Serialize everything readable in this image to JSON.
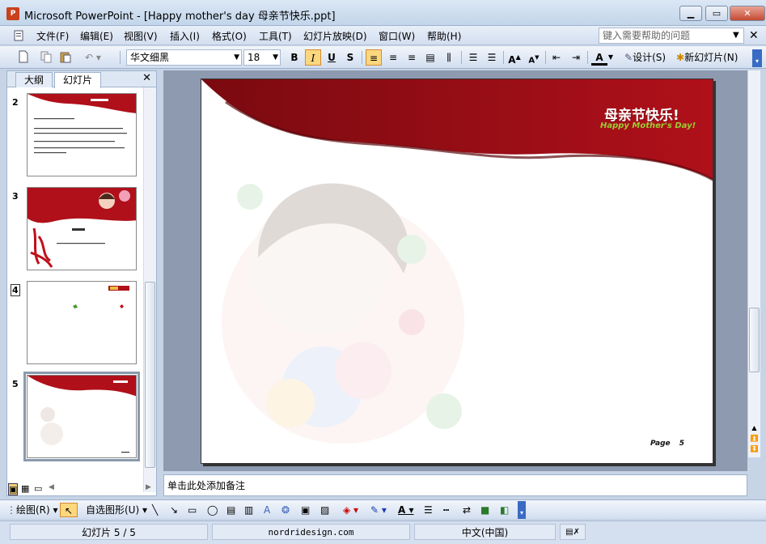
{
  "window": {
    "title": "Microsoft PowerPoint - [Happy mother's day 母亲节快乐.ppt]",
    "app_icon_text": "P"
  },
  "menu": {
    "items": [
      "文件(F)",
      "编辑(E)",
      "视图(V)",
      "插入(I)",
      "格式(O)",
      "工具(T)",
      "幻灯片放映(D)",
      "窗口(W)",
      "帮助(H)"
    ],
    "help_placeholder": "键入需要帮助的问题"
  },
  "toolbar": {
    "font_name": "华文细黑",
    "font_size": "18",
    "bold": "B",
    "italic": "I",
    "underline": "U",
    "shadow": "S",
    "design": "设计(S)",
    "new_slide": "新幻灯片(N)"
  },
  "outline_pane": {
    "tabs": [
      "大纲",
      "幻灯片"
    ],
    "slide_numbers": [
      "2",
      "3",
      "4",
      "5"
    ],
    "selected_slide": "5"
  },
  "slide": {
    "title_cn": "母亲节快乐!",
    "title_en": "Happy Mother's Day!",
    "page_label": "Page",
    "page_number": "5",
    "colors": {
      "banner": "#b0101a",
      "banner_dark": "#7a0a10",
      "title_en": "#9acd32"
    }
  },
  "notes": {
    "placeholder": "单击此处添加备注"
  },
  "drawbar": {
    "draw": "绘图(R)",
    "autoshapes": "自选图形(U)"
  },
  "status": {
    "slide_info": "幻灯片 5 / 5",
    "design_name": "nordridesign.com",
    "language": "中文(中国)"
  }
}
